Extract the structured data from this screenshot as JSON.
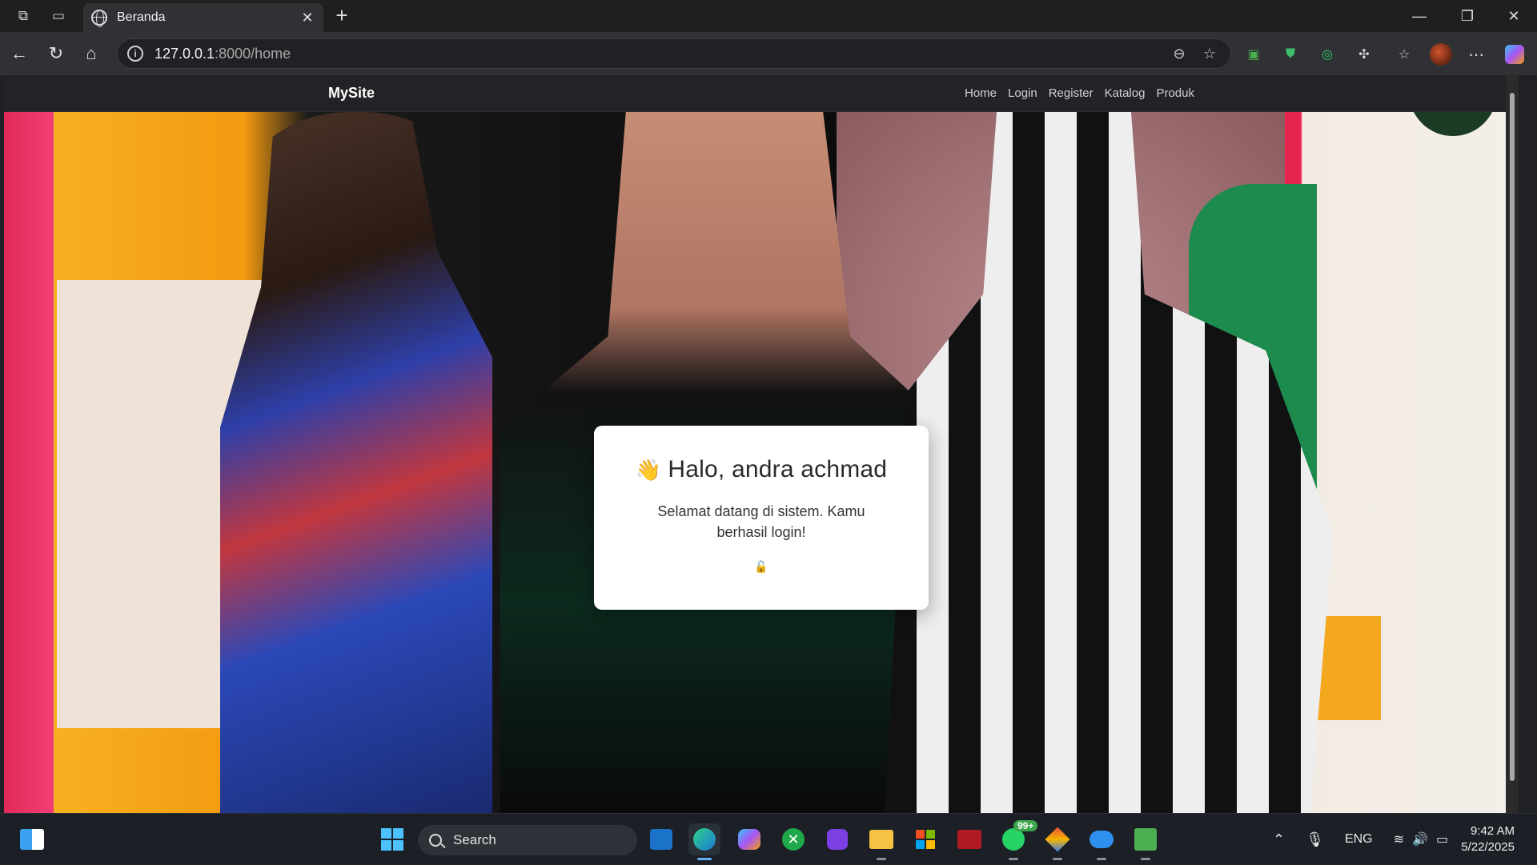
{
  "browser": {
    "tab_title": "Beranda",
    "url_host": "127.0.0.1",
    "url_path": ":8000/home"
  },
  "site": {
    "brand": "MySite",
    "nav": [
      "Home",
      "Login",
      "Register",
      "Katalog",
      "Produk"
    ]
  },
  "card": {
    "wave_emoji": "👋",
    "greeting": "Halo, andra achmad",
    "message": "Selamat datang di sistem. Kamu berhasil login!",
    "lock_emoji": "🔓"
  },
  "taskbar": {
    "search_placeholder": "Search",
    "whatsapp_badge": "99+",
    "language": "ENG",
    "time": "9:42 AM",
    "date": "5/22/2025"
  }
}
